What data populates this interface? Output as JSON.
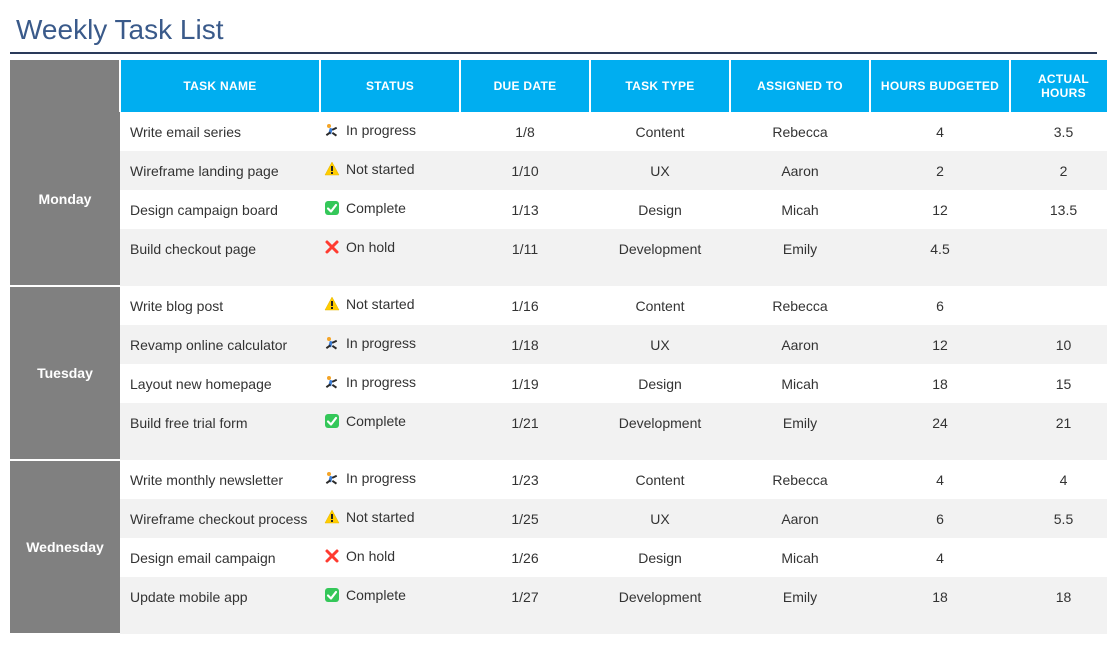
{
  "page_title": "Weekly Task List",
  "columns": {
    "task_name": "TASK NAME",
    "status": "STATUS",
    "due_date": "DUE DATE",
    "task_type": "TASK TYPE",
    "assigned_to": "ASSIGNED TO",
    "hours_budgeted": "HOURS BUDGETED",
    "actual_hours": "ACTUAL HOURS"
  },
  "status_labels": {
    "in_progress": "In progress",
    "not_started": "Not started",
    "complete": "Complete",
    "on_hold": "On hold"
  },
  "groups": [
    {
      "day": "Monday",
      "tasks": [
        {
          "name": "Write email series",
          "status": "in_progress",
          "due": "1/8",
          "type": "Content",
          "assigned": "Rebecca",
          "budget": "4",
          "actual": "3.5"
        },
        {
          "name": "Wireframe landing page",
          "status": "not_started",
          "due": "1/10",
          "type": "UX",
          "assigned": "Aaron",
          "budget": "2",
          "actual": "2"
        },
        {
          "name": "Design campaign board",
          "status": "complete",
          "due": "1/13",
          "type": "Design",
          "assigned": "Micah",
          "budget": "12",
          "actual": "13.5"
        },
        {
          "name": "Build checkout page",
          "status": "on_hold",
          "due": "1/11",
          "type": "Development",
          "assigned": "Emily",
          "budget": "4.5",
          "actual": ""
        }
      ]
    },
    {
      "day": "Tuesday",
      "tasks": [
        {
          "name": "Write blog post",
          "status": "not_started",
          "due": "1/16",
          "type": "Content",
          "assigned": "Rebecca",
          "budget": "6",
          "actual": ""
        },
        {
          "name": "Revamp online calculator",
          "status": "in_progress",
          "due": "1/18",
          "type": "UX",
          "assigned": "Aaron",
          "budget": "12",
          "actual": "10"
        },
        {
          "name": "Layout new homepage",
          "status": "in_progress",
          "due": "1/19",
          "type": "Design",
          "assigned": "Micah",
          "budget": "18",
          "actual": "15"
        },
        {
          "name": "Build free trial form",
          "status": "complete",
          "due": "1/21",
          "type": "Development",
          "assigned": "Emily",
          "budget": "24",
          "actual": "21"
        }
      ]
    },
    {
      "day": "Wednesday",
      "tasks": [
        {
          "name": "Write monthly newsletter",
          "status": "in_progress",
          "due": "1/23",
          "type": "Content",
          "assigned": "Rebecca",
          "budget": "4",
          "actual": "4"
        },
        {
          "name": "Wireframe checkout process",
          "status": "not_started",
          "due": "1/25",
          "type": "UX",
          "assigned": "Aaron",
          "budget": "6",
          "actual": "5.5"
        },
        {
          "name": "Design email campaign",
          "status": "on_hold",
          "due": "1/26",
          "type": "Design",
          "assigned": "Micah",
          "budget": "4",
          "actual": ""
        },
        {
          "name": "Update mobile app",
          "status": "complete",
          "due": "1/27",
          "type": "Development",
          "assigned": "Emily",
          "budget": "18",
          "actual": "18"
        }
      ]
    }
  ]
}
